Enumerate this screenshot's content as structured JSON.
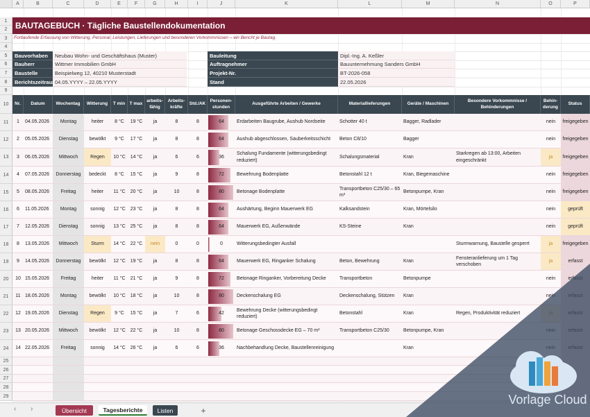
{
  "columns": [
    "A",
    "B",
    "C",
    "D",
    "E",
    "F",
    "G",
    "H",
    "I",
    "J",
    "K",
    "L",
    "M",
    "N",
    "O",
    "P"
  ],
  "title": "BAUTAGEBUCH · Tägliche Baustellendokumentation",
  "subtitle": "Fortlaufende Erfassung von Witterung, Personal, Leistungen, Lieferungen und besonderen Vorkommnissen – ein Bericht je Bautag.",
  "info_left": [
    {
      "label": "Bauvorhaben",
      "value": "Neubau Wohn- und Geschäftshaus (Muster)"
    },
    {
      "label": "Bauherr",
      "value": "Wittmer Immobilien GmbH"
    },
    {
      "label": "Baustelle",
      "value": "Beispielweg 12, 40210 Musterstadt"
    },
    {
      "label": "Berichtszeitraum",
      "value": "04.05.YYYY  –  22.05.YYYY"
    }
  ],
  "info_right": [
    {
      "label": "Bauleitung",
      "value": "Dipl.-Ing. A. Keßler"
    },
    {
      "label": "Auftragnehmer",
      "value": "Bauunternehmung Sanders GmbH"
    },
    {
      "label": "Projekt-Nr.",
      "value": "BT-2026-058"
    },
    {
      "label": "Stand",
      "value": "22.05.2026"
    }
  ],
  "headers": [
    "Nr.",
    "Datum",
    "Wochentag",
    "Witterung",
    "T min",
    "T max",
    "arbeits-fähig",
    "Arbeits-kräfte",
    "Std./AK",
    "Personen-stunden",
    "Ausgeführte Arbeiten / Gewerke",
    "Materiallieferungen",
    "Geräte / Maschinen",
    "Besondere Vorkommnisse / Behinderungen",
    "Behin-derung",
    "Status"
  ],
  "rows": [
    {
      "nr": "1",
      "datum": "04.05.2026",
      "tag": "Montag",
      "wetter": "heiter",
      "tmin": "8 °C",
      "tmax": "19 °C",
      "fahig": "ja",
      "ak": "8",
      "std": "8",
      "ps": "64",
      "psv": 64,
      "arbeit": "Erdarbeiten Baugrube, Aushub Nordseite",
      "material": "Schotter 40 t",
      "gerate": "Bagger, Radlader",
      "vork": "",
      "beh": "nein",
      "status": "freigegeben"
    },
    {
      "nr": "2",
      "datum": "05.05.2026",
      "tag": "Dienstag",
      "wetter": "bewölkt",
      "tmin": "9 °C",
      "tmax": "17 °C",
      "fahig": "ja",
      "ak": "8",
      "std": "8",
      "ps": "64",
      "psv": 64,
      "arbeit": "Aushub abgeschlossen, Sauberkeitsschicht",
      "material": "Beton C8/10",
      "gerate": "Bagger",
      "vork": "",
      "beh": "nein",
      "status": "freigegeben"
    },
    {
      "nr": "3",
      "datum": "06.05.2026",
      "tag": "Mittwoch",
      "wetter": "Regen",
      "tmin": "10 °C",
      "tmax": "14 °C",
      "fahig": "ja",
      "ak": "6",
      "std": "6",
      "ps": "36",
      "psv": 36,
      "arbeit": "Schalung Fundamente (witterungsbedingt reduziert)",
      "material": "Schalungsmaterial",
      "gerate": "Kran",
      "vork": "Starkregen ab 13:00, Arbeiten eingeschränkt",
      "beh": "ja",
      "status": "freigegeben"
    },
    {
      "nr": "4",
      "datum": "07.05.2026",
      "tag": "Donnerstag",
      "wetter": "bedeckt",
      "tmin": "8 °C",
      "tmax": "15 °C",
      "fahig": "ja",
      "ak": "9",
      "std": "8",
      "ps": "72",
      "psv": 72,
      "arbeit": "Bewehrung Bodenplatte",
      "material": "Betonstahl 12 t",
      "gerate": "Kran, Biegemaschine",
      "vork": "",
      "beh": "nein",
      "status": "freigegeben"
    },
    {
      "nr": "5",
      "datum": "08.05.2026",
      "tag": "Freitag",
      "wetter": "heiter",
      "tmin": "11 °C",
      "tmax": "20 °C",
      "fahig": "ja",
      "ak": "10",
      "std": "8",
      "ps": "80",
      "psv": 80,
      "arbeit": "Betonage Bodenplatte",
      "material": "Transportbeton C25/30 – 65 m³",
      "gerate": "Betonpumpe, Kran",
      "vork": "",
      "beh": "nein",
      "status": "freigegeben"
    },
    {
      "nr": "6",
      "datum": "11.05.2026",
      "tag": "Montag",
      "wetter": "sonnig",
      "tmin": "12 °C",
      "tmax": "23 °C",
      "fahig": "ja",
      "ak": "8",
      "std": "8",
      "ps": "64",
      "psv": 64,
      "arbeit": "Aushärtung, Beginn Mauerwerk EG",
      "material": "Kalksandstein",
      "gerate": "Kran, Mörtelsilo",
      "vork": "",
      "beh": "nein",
      "status": "geprüft"
    },
    {
      "nr": "7",
      "datum": "12.05.2026",
      "tag": "Dienstag",
      "wetter": "sonnig",
      "tmin": "13 °C",
      "tmax": "25 °C",
      "fahig": "ja",
      "ak": "8",
      "std": "8",
      "ps": "64",
      "psv": 64,
      "arbeit": "Mauerwerk EG, Außenwände",
      "material": "KS-Steine",
      "gerate": "Kran",
      "vork": "",
      "beh": "nein",
      "status": "geprüft"
    },
    {
      "nr": "8",
      "datum": "13.05.2026",
      "tag": "Mittwoch",
      "wetter": "Sturm",
      "tmin": "14 °C",
      "tmax": "22 °C",
      "fahig": "nein",
      "ak": "0",
      "std": "0",
      "ps": "0",
      "psv": 0,
      "arbeit": "Witterungsbedingter Ausfall",
      "material": "",
      "gerate": "",
      "vork": "Sturmwarnung, Baustelle gesperrt",
      "beh": "ja",
      "status": "freigegeben"
    },
    {
      "nr": "9",
      "datum": "14.05.2026",
      "tag": "Donnerstag",
      "wetter": "bewölkt",
      "tmin": "12 °C",
      "tmax": "19 °C",
      "fahig": "ja",
      "ak": "8",
      "std": "8",
      "ps": "64",
      "psv": 64,
      "arbeit": "Mauerwerk EG, Ringanker Schalung",
      "material": "Beton, Bewehrung",
      "gerate": "Kran",
      "vork": "Fensteranlieferung um 1 Tag verschoben",
      "beh": "ja",
      "status": "erfasst"
    },
    {
      "nr": "10",
      "datum": "15.05.2026",
      "tag": "Freitag",
      "wetter": "heiter",
      "tmin": "11 °C",
      "tmax": "21 °C",
      "fahig": "ja",
      "ak": "9",
      "std": "8",
      "ps": "72",
      "psv": 72,
      "arbeit": "Betonage Ringanker, Vorbereitung Decke",
      "material": "Transportbeton",
      "gerate": "Betonpumpe",
      "vork": "",
      "beh": "nein",
      "status": "erfasst"
    },
    {
      "nr": "11",
      "datum": "18.05.2026",
      "tag": "Montag",
      "wetter": "bewölkt",
      "tmin": "10 °C",
      "tmax": "18 °C",
      "fahig": "ja",
      "ak": "10",
      "std": "8",
      "ps": "80",
      "psv": 80,
      "arbeit": "Deckenschalung EG",
      "material": "Deckenschalung, Stützen",
      "gerate": "Kran",
      "vork": "",
      "beh": "nein",
      "status": "erfasst"
    },
    {
      "nr": "12",
      "datum": "19.05.2026",
      "tag": "Dienstag",
      "wetter": "Regen",
      "tmin": "9 °C",
      "tmax": "15 °C",
      "fahig": "ja",
      "ak": "7",
      "std": "6",
      "ps": "42",
      "psv": 42,
      "arbeit": "Bewehrung Decke (witterungsbedingt reduziert)",
      "material": "Betonstahl",
      "gerate": "Kran",
      "vork": "Regen, Produktivität reduziert",
      "beh": "ja",
      "status": "erfasst"
    },
    {
      "nr": "13",
      "datum": "20.05.2026",
      "tag": "Mittwoch",
      "wetter": "bewölkt",
      "tmin": "12 °C",
      "tmax": "22 °C",
      "fahig": "ja",
      "ak": "10",
      "std": "8",
      "ps": "80",
      "psv": 80,
      "arbeit": "Betonage Geschossdecke EG – 70 m³",
      "material": "Transportbeton C25/30",
      "gerate": "Betonpumpe, Kran",
      "vork": "",
      "beh": "nein",
      "status": "erfasst"
    },
    {
      "nr": "14",
      "datum": "22.05.2026",
      "tag": "Freitag",
      "wetter": "sonnig",
      "tmin": "14 °C",
      "tmax": "26 °C",
      "fahig": "ja",
      "ak": "6",
      "std": "6",
      "ps": "36",
      "psv": 36,
      "arbeit": "Nachbehandlung Decke, Baustellenreinigung",
      "material": "",
      "gerate": "Kran",
      "vork": "",
      "beh": "nein",
      "status": "erfasst"
    }
  ],
  "tabs": {
    "t1": "Übersicht",
    "t2": "Tagesberichte",
    "t3": "Listen",
    "add": "+"
  },
  "watermark": "Vorlage Cloud",
  "colors": {
    "accent": "#7a1f35",
    "header": "#3a4750",
    "light": "#faf1f3",
    "yellow": "#fbe9c6"
  }
}
